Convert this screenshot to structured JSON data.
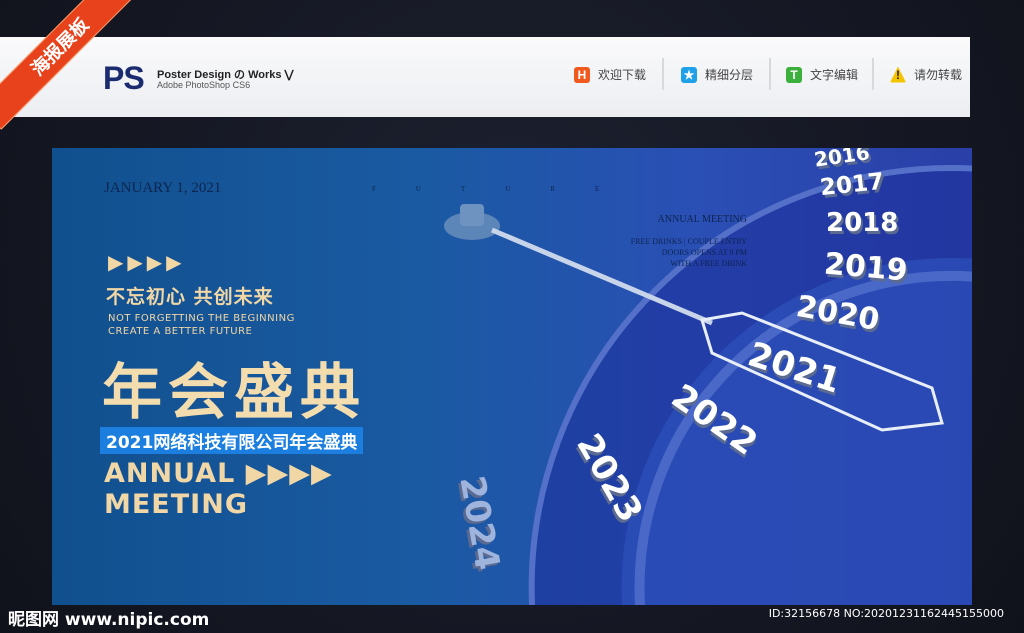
{
  "ribbon": "海报展板",
  "header": {
    "logo": "PS",
    "title": "Poster Design の Works ⋁",
    "subtitle": "Adobe PhotoShop CS6",
    "actions": [
      {
        "icon": "H",
        "label": "欢迎下载",
        "color": "#f05a1e"
      },
      {
        "icon": "★",
        "label": "精细分层",
        "color": "#1fa0e8"
      },
      {
        "icon": "T",
        "label": "文字编辑",
        "color": "#3cb03c"
      },
      {
        "icon": "!",
        "label": "请勿转载",
        "color": "#f5c400"
      }
    ]
  },
  "poster": {
    "date": "JANUARY 1, 2021",
    "future": "FUTURE",
    "arrows": "▶▶▶▶",
    "slogan": "不忘初心 共创未来",
    "en1": "NOT FORGETTING THE BEGINNING",
    "en2": "CREATE A BETTER FUTURE",
    "title": "年会盛典",
    "subtitle": "2021网络科技有限公司年会盛典",
    "annual": "ANNUAL ▶▶▶▶",
    "meeting": "MEETING",
    "am_title": "ANNUAL MEETING",
    "am_l1": "FREE DRINKS | COUPLE ENTRY",
    "am_l2": "DOORS OPENS AT 9 PM",
    "am_l3": "WITH A FREE DRINK",
    "years": [
      "2016",
      "2017",
      "2018",
      "2019",
      "2020",
      "2021",
      "2022",
      "2023",
      "2024"
    ]
  },
  "footer": {
    "site": "昵图网 www.nipic.com",
    "id": "ID:32156678 NO:20201231162445155000"
  }
}
